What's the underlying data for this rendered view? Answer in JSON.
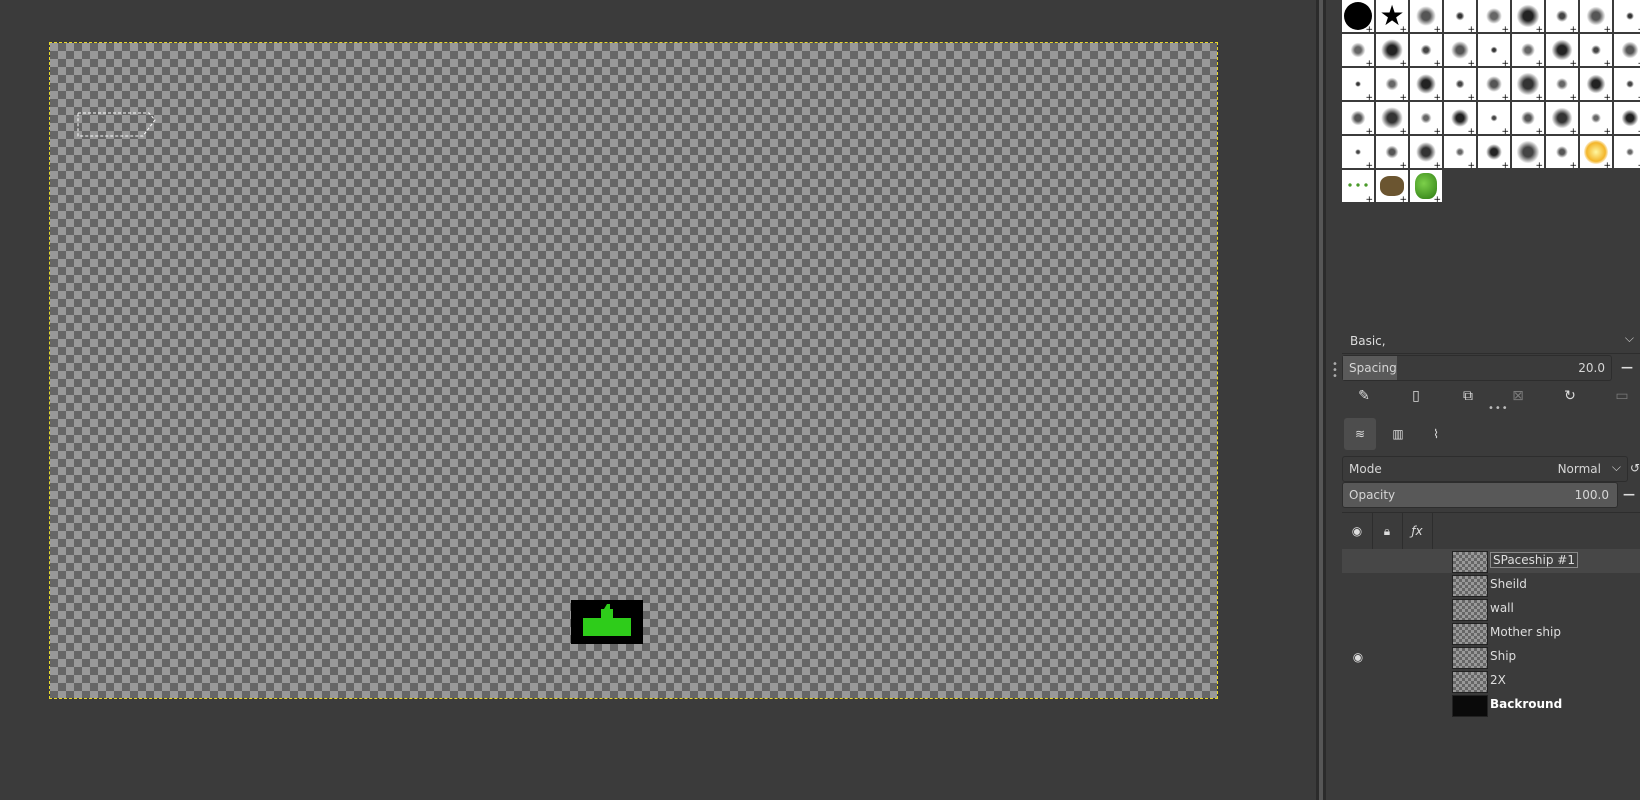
{
  "brushes": {
    "tag_filter": "Basic,",
    "spacing_label": "Spacing",
    "spacing_value": "20.0",
    "spacing_fraction": 0.2
  },
  "layers_panel": {
    "mode_label": "Mode",
    "mode_value": "Normal",
    "opacity_label": "Opacity",
    "opacity_value": "100.0",
    "layers": [
      {
        "name": "SPaceship #1",
        "visible": false,
        "active": true
      },
      {
        "name": "Sheild",
        "visible": false
      },
      {
        "name": "wall",
        "visible": false
      },
      {
        "name": "Mother ship",
        "visible": false
      },
      {
        "name": "Ship",
        "visible": true
      },
      {
        "name": "2X",
        "visible": false
      },
      {
        "name": "Backround",
        "visible": false,
        "bold": true
      }
    ]
  },
  "colors": {
    "selection_boundary": "#e8d82a",
    "ship_green": "#2ecc1a"
  },
  "icons": {
    "edit": "edit-brush-icon",
    "new": "new-brush-icon",
    "duplicate": "duplicate-brush-icon",
    "delete": "delete-brush-icon",
    "refresh": "refresh-brushes-icon",
    "open": "open-as-image-icon",
    "layers_tab": "layers-icon",
    "channels_tab": "channels-icon",
    "paths_tab": "paths-icon",
    "visibility": "eye-icon",
    "lock": "lock-icon",
    "effects": "fx-icon"
  }
}
